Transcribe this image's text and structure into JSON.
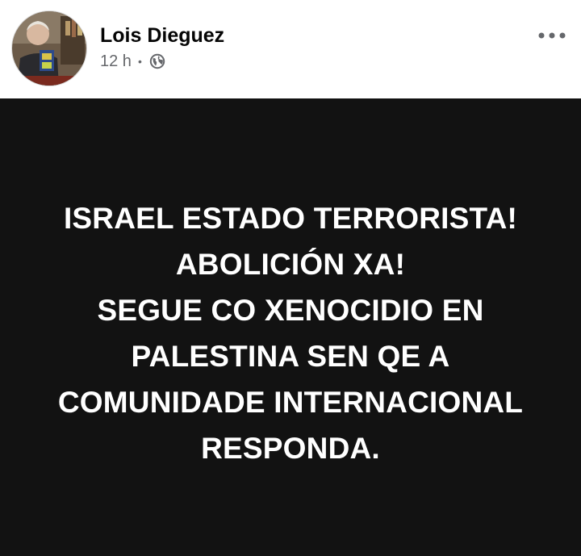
{
  "author": {
    "name": "Lois Dieguez",
    "avatar": "profile-photo"
  },
  "meta": {
    "time": "12 h",
    "separator": "•",
    "audience_icon": "globe-icon"
  },
  "actions": {
    "more_icon": "more-options-icon"
  },
  "post": {
    "background_color": "#121212",
    "text_color": "#ffffff",
    "lines": [
      "ISRAEL ESTADO TERRORISTA!",
      "ABOLICIÓN XA!",
      "SEGUE CO XENOCIDIO EN",
      "PALESTINA SEN QE A",
      "COMUNIDADE INTERNACIONAL",
      "RESPONDA."
    ]
  }
}
